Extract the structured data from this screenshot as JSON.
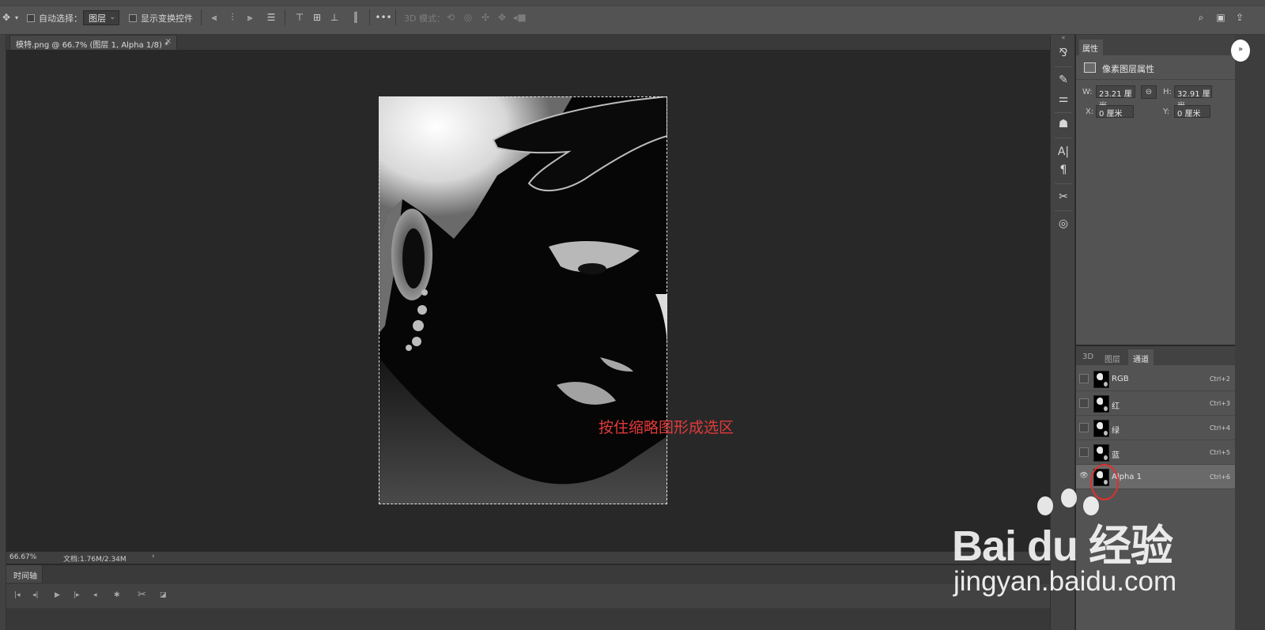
{
  "options_bar": {
    "auto_select_label": "自动选择：",
    "layer_select_value": "图层",
    "show_transform_label": "显示变换控件",
    "mode_3d_label": "3D 模式："
  },
  "document": {
    "tab_title": "模特.png @ 66.7% (图层 1, Alpha 1/8) *",
    "close_glyph": "×"
  },
  "canvas": {
    "annotation_text": "按住缩略图形成选区"
  },
  "status_bar": {
    "zoom": "66.67%",
    "doc_info": "文档:1.76M/2.34M",
    "arrow": "›"
  },
  "timeline": {
    "tab_label": "时间轴"
  },
  "properties": {
    "tab_label": "属性",
    "section_label": "像素图层属性",
    "w_label": "W:",
    "w_value": "23.21 厘米",
    "h_label": "H:",
    "h_value": "32.91 厘米",
    "x_label": "X:",
    "x_value": "0 厘米",
    "y_label": "Y:",
    "y_value": "0 厘米"
  },
  "channels_panel": {
    "tabs": [
      {
        "label": "3D"
      },
      {
        "label": "图层"
      },
      {
        "label": "通道"
      }
    ],
    "active_tab": "通道",
    "rows": [
      {
        "name": "RGB",
        "shortcut": "Ctrl+2",
        "visible": false
      },
      {
        "name": "红",
        "shortcut": "Ctrl+3",
        "visible": false
      },
      {
        "name": "绿",
        "shortcut": "Ctrl+4",
        "visible": false
      },
      {
        "name": "蓝",
        "shortcut": "Ctrl+5",
        "visible": false
      },
      {
        "name": "Alpha 1",
        "shortcut": "Ctrl+6",
        "visible": true
      }
    ]
  },
  "watermark": {
    "main": "Bai du 经验",
    "sub": "jingyan.baidu.com"
  },
  "colors": {
    "annotation_red": "#e23a3a",
    "panel_bg": "#535353",
    "canvas_bg": "#282828"
  }
}
